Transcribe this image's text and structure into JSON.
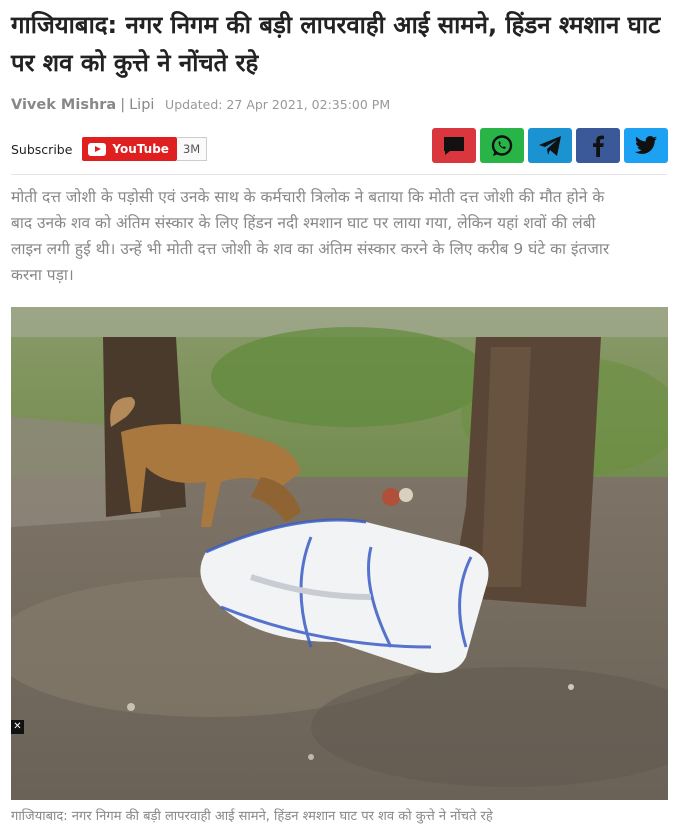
{
  "article": {
    "headline": "गाजियाबाद: नगर निगम की बड़ी लापरवाही आई सामने, हिंडन श्मशान घाट पर शव को कुत्ते ने नोंचते रहे",
    "author": "Vivek Mishra",
    "separator": "|",
    "source": "Lipi",
    "updated": "Updated: 27 Apr 2021, 02:35:00 PM",
    "lede": "मोती दत्त जोशी के पड़ोसी एवं उनके साथ के कर्मचारी त्रिलोक ने बताया कि मोती दत्त जोशी की मौत होने के बाद उनके शव को अंतिम संस्कार के लिए हिंडन नदी श्मशान घाट पर लाया गया, लेकिन यहां शवों की लंबी लाइन लगी हुई थी। उन्हें भी मोती दत्त जोशी के शव का अंतिम संस्कार करने के लिए करीब 9 घंटे का इंतजार करना पड़ा।",
    "photo_caption": "गाजियाबाद: नगर निगम की बड़ी लापरवाही आई सामने, हिंडन श्मशान घाट पर शव को कुत्ते ने नोंचते रहे",
    "photo_close_glyph": "✕"
  },
  "subscribe": {
    "label": "Subscribe",
    "youtube_label": "YouTube",
    "count": "3M"
  },
  "share": [
    {
      "name": "comment-icon",
      "color": "#d9363e"
    },
    {
      "name": "whatsapp-icon",
      "color": "#28b446"
    },
    {
      "name": "telegram-icon",
      "color": "#1c93d1"
    },
    {
      "name": "facebook-icon",
      "color": "#3b5998"
    },
    {
      "name": "twitter-icon",
      "color": "#1da1f2"
    }
  ]
}
